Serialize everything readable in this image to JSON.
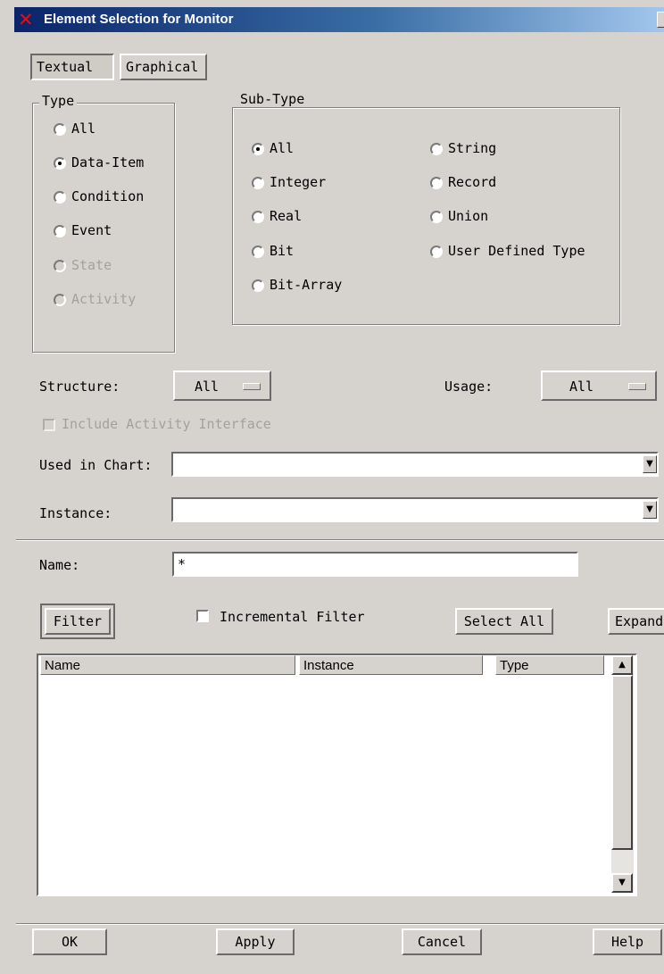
{
  "window": {
    "title": "Element Selection for Monitor"
  },
  "tabs": {
    "textual": "Textual",
    "graphical": "Graphical"
  },
  "type_group": {
    "label": "Type",
    "options": [
      "All",
      "Data-Item",
      "Condition",
      "Event",
      "State",
      "Activity"
    ],
    "selected": "Data-Item"
  },
  "subtype_group": {
    "label": "Sub-Type",
    "options_left": [
      "All",
      "Integer",
      "Real",
      "Bit",
      "Bit-Array"
    ],
    "options_right": [
      "String",
      "Record",
      "Union",
      "User Defined Type"
    ],
    "selected": "All"
  },
  "structure": {
    "label": "Structure:",
    "value": "All"
  },
  "usage": {
    "label": "Usage:",
    "value": "All"
  },
  "include_activity_interface": {
    "label": "Include Activity Interface",
    "checked": false
  },
  "used_in_chart": {
    "label": "Used in Chart:",
    "value": ""
  },
  "instance": {
    "label": "Instance:",
    "value": ""
  },
  "name": {
    "label": "Name:",
    "value": "*"
  },
  "filter": {
    "filter_button": "Filter",
    "incremental_label": "Incremental Filter",
    "incremental_checked": false,
    "select_all_button": "Select All",
    "expand_button": "Expand"
  },
  "table": {
    "columns": [
      "Name",
      "Instance",
      "Type"
    ],
    "rows": []
  },
  "footer": {
    "ok": "OK",
    "apply": "Apply",
    "cancel": "Cancel",
    "help": "Help"
  },
  "colors": {
    "background": "#d6d3ce",
    "titlebar": "#0a246a"
  }
}
